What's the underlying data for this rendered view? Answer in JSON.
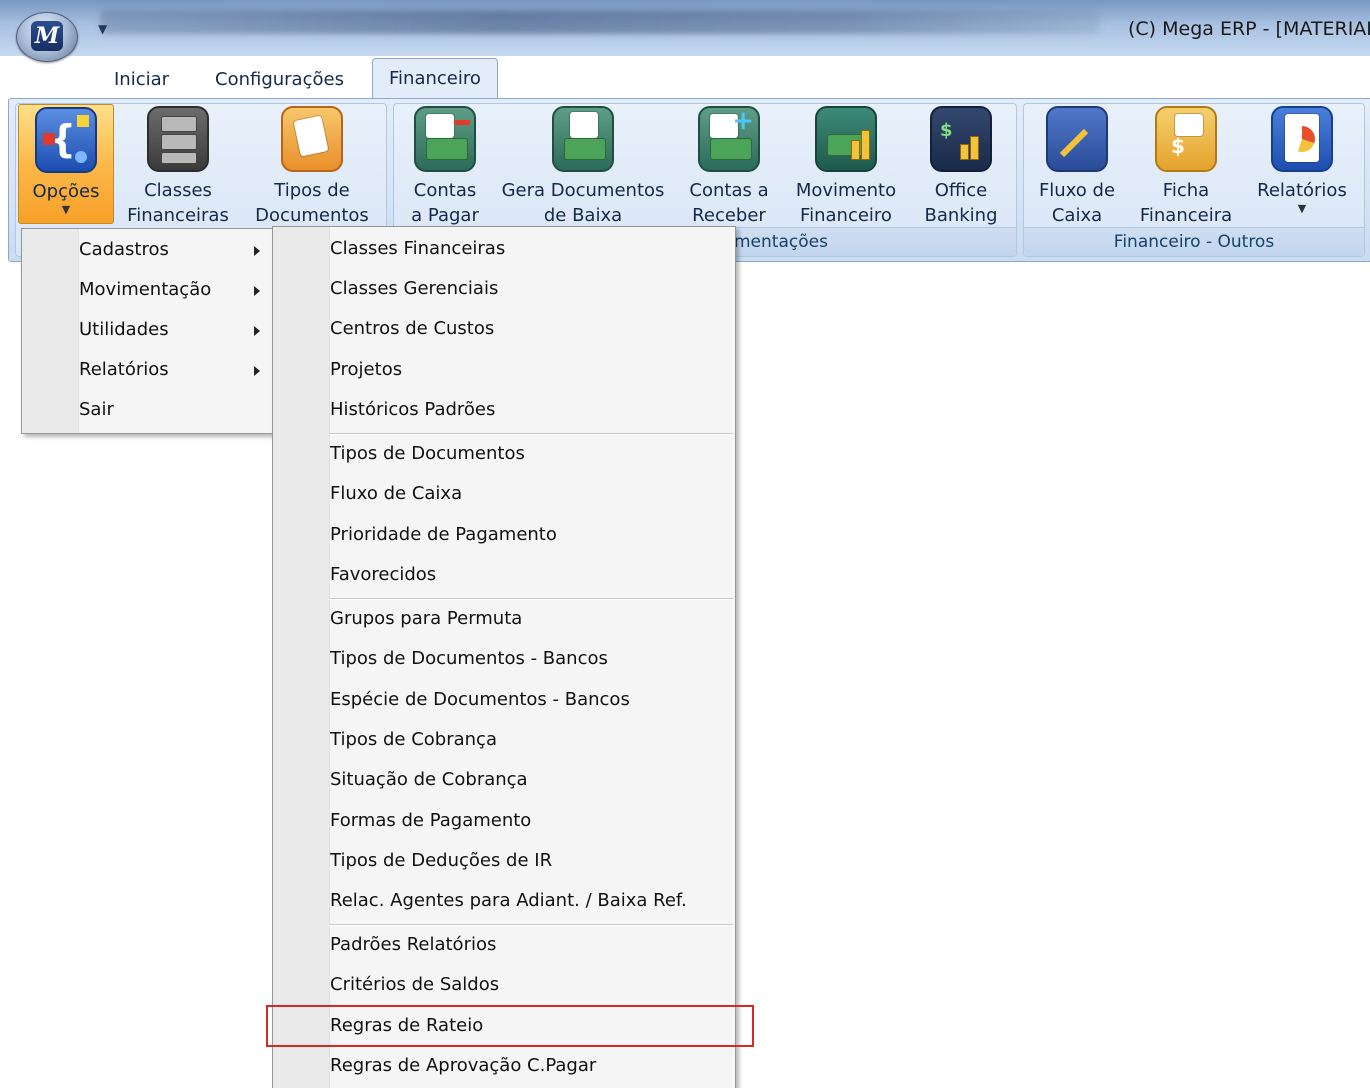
{
  "window": {
    "title": "(C)  Mega ERP - [MATERIAL",
    "orb_letter": "M"
  },
  "tabs": [
    {
      "label": "Iniciar"
    },
    {
      "label": "Configurações"
    },
    {
      "label": "Financeiro",
      "active": true
    }
  ],
  "ribbon": {
    "buttons": [
      {
        "label1": "Opções",
        "label2": "",
        "icon": "options-icon",
        "active": true
      },
      {
        "label1": "Classes",
        "label2": "Financeiras",
        "icon": "file-cabinet-icon"
      },
      {
        "label1": "Tipos de",
        "label2": "Documentos",
        "icon": "documents-icon"
      },
      {
        "label1": "Contas",
        "label2": "a Pagar",
        "icon": "accounts-payable-icon"
      },
      {
        "label1": "Gera Documentos",
        "label2": "de Baixa",
        "icon": "money-document-icon"
      },
      {
        "label1": "Contas a",
        "label2": "Receber",
        "icon": "accounts-receivable-icon"
      },
      {
        "label1": "Movimento",
        "label2": "Financeiro",
        "icon": "financial-movement-icon"
      },
      {
        "label1": "Office",
        "label2": "Banking",
        "icon": "office-banking-icon"
      },
      {
        "label1": "Fluxo de",
        "label2": "Caixa",
        "icon": "cash-flow-icon"
      },
      {
        "label1": "Ficha",
        "label2": "Financeira",
        "icon": "financial-sheet-icon"
      },
      {
        "label1": "Relatórios",
        "label2": "",
        "icon": "reports-icon"
      }
    ],
    "groups": [
      {
        "label": "mentações"
      },
      {
        "label": "Financeiro - Outros"
      }
    ]
  },
  "options_menu": {
    "items": [
      {
        "label": "Cadastros",
        "has_submenu": true
      },
      {
        "label": "Movimentação",
        "has_submenu": true
      },
      {
        "label": "Utilidades",
        "has_submenu": true
      },
      {
        "label": "Relatórios",
        "has_submenu": true
      },
      {
        "label": "Sair",
        "has_submenu": false
      }
    ]
  },
  "cadastros_submenu": {
    "items": [
      {
        "label": "Classes Financeiras"
      },
      {
        "label": "Classes Gerenciais"
      },
      {
        "label": "Centros de Custos"
      },
      {
        "label": "Projetos"
      },
      {
        "label": "Históricos Padrões"
      },
      {
        "label": "Tipos de Documentos"
      },
      {
        "label": "Fluxo de Caixa"
      },
      {
        "label": "Prioridade de Pagamento"
      },
      {
        "label": "Favorecidos"
      },
      {
        "label": "Grupos para Permuta"
      },
      {
        "label": "Tipos de Documentos - Bancos"
      },
      {
        "label": "Espécie de Documentos - Bancos"
      },
      {
        "label": "Tipos de Cobrança"
      },
      {
        "label": "Situação de Cobrança"
      },
      {
        "label": "Formas de Pagamento"
      },
      {
        "label": "Tipos de Deduções de IR"
      },
      {
        "label": "Relac. Agentes para Adiant. / Baixa Ref."
      },
      {
        "label": "Padrões Relatórios"
      },
      {
        "label": "Critérios de Saldos"
      },
      {
        "label": "Regras de Rateio",
        "highlighted": true
      },
      {
        "label": "Regras de Aprovação C.Pagar"
      }
    ]
  },
  "colors": {
    "highlight_border": "#d62a2a",
    "ribbon_active": "#fbb94a"
  }
}
